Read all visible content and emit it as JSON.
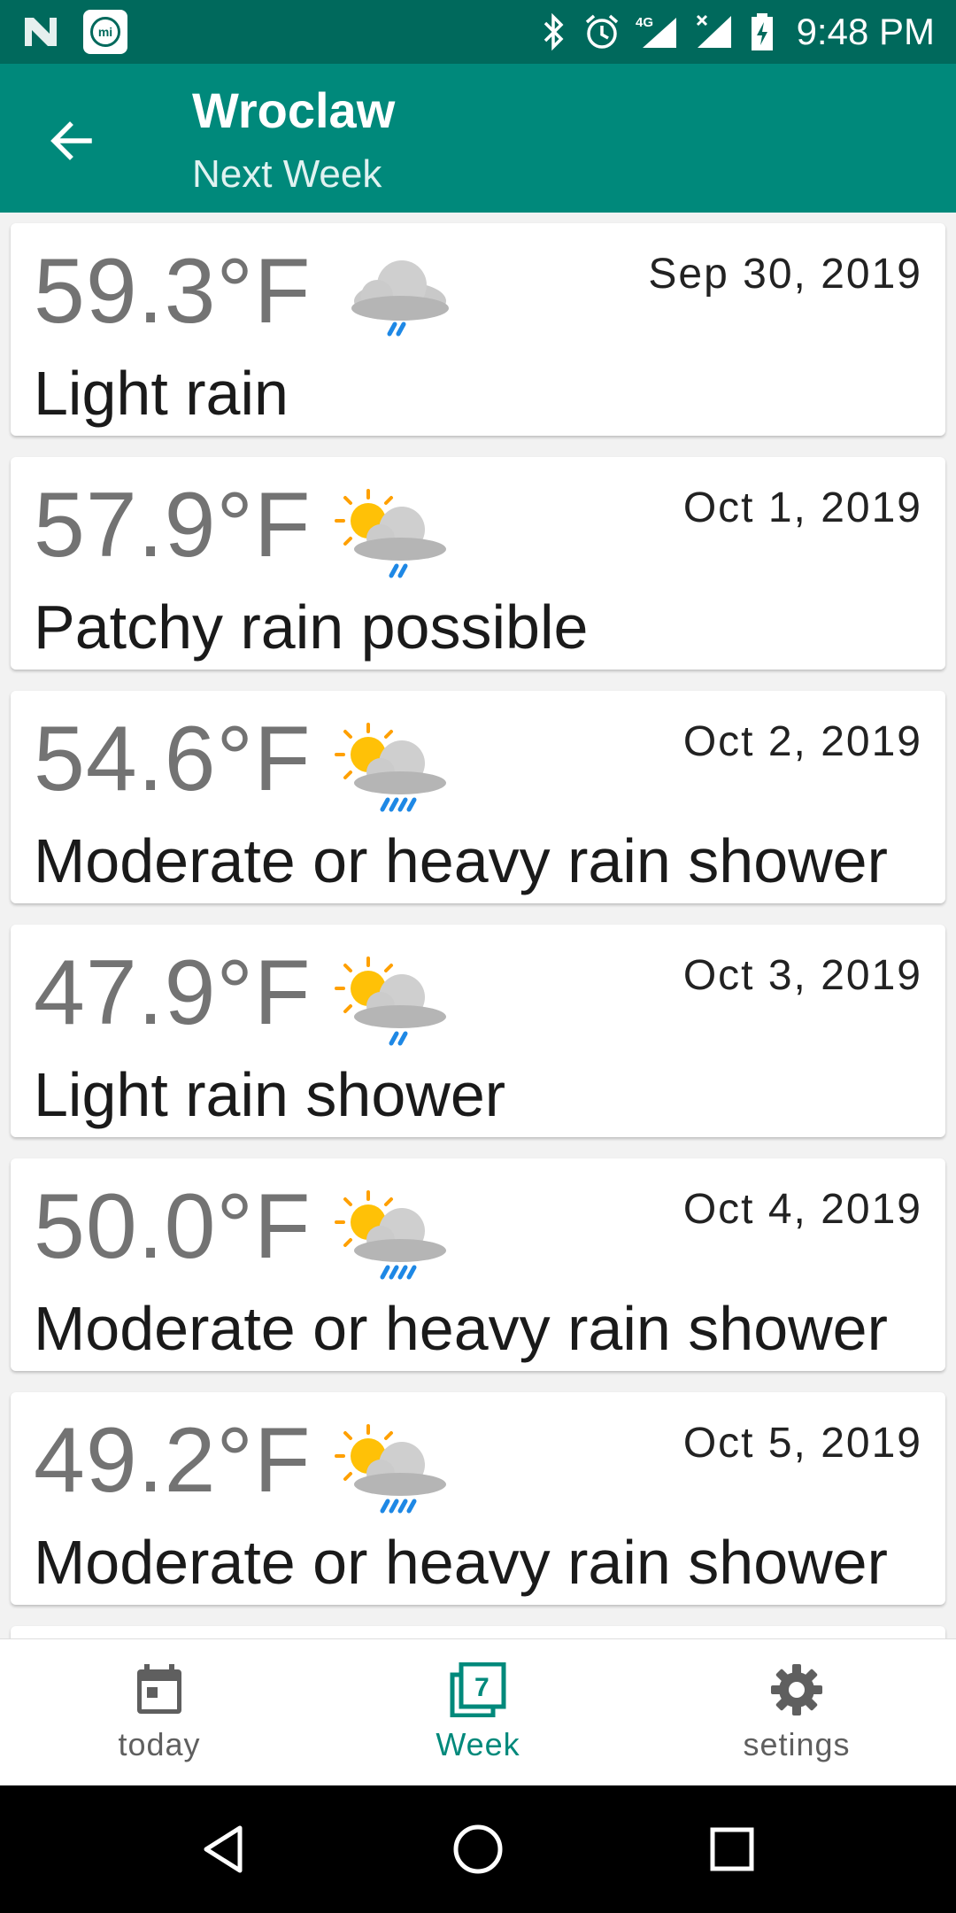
{
  "status_bar": {
    "time": "9:48 PM",
    "network": "4G",
    "icons": [
      "n-logo-icon",
      "mi-app-icon",
      "bluetooth-icon",
      "alarm-icon",
      "signal-4g-icon",
      "signal-x-icon",
      "battery-charging-icon"
    ]
  },
  "app_bar": {
    "title": "Wroclaw",
    "subtitle": "Next Week",
    "back_icon": "arrow-back-icon"
  },
  "forecast": [
    {
      "temp": "59.3°F",
      "date": "Sep 30, 2019",
      "desc": "Light rain",
      "icon": "cloud-light-rain-icon"
    },
    {
      "temp": "57.9°F",
      "date": "Oct 1, 2019",
      "desc": "Patchy rain possible",
      "icon": "sun-cloud-light-rain-icon"
    },
    {
      "temp": "54.6°F",
      "date": "Oct 2, 2019",
      "desc": "Moderate or heavy rain shower",
      "icon": "sun-cloud-heavy-rain-icon"
    },
    {
      "temp": "47.9°F",
      "date": "Oct 3, 2019",
      "desc": "Light rain shower",
      "icon": "sun-cloud-light-rain-icon"
    },
    {
      "temp": "50.0°F",
      "date": "Oct 4, 2019",
      "desc": "Moderate or heavy rain shower",
      "icon": "sun-cloud-heavy-rain-icon"
    },
    {
      "temp": "49.2°F",
      "date": "Oct 5, 2019",
      "desc": "Moderate or heavy rain shower",
      "icon": "sun-cloud-heavy-rain-icon"
    }
  ],
  "bottom_nav": [
    {
      "label": "today",
      "icon": "calendar-icon",
      "active": false
    },
    {
      "label": "Week",
      "icon": "week-calendar-icon",
      "active": true,
      "badge": "7"
    },
    {
      "label": "setings",
      "icon": "gear-icon",
      "active": false
    }
  ],
  "colors": {
    "status_bar": "#00695c",
    "app_bar": "#00897b",
    "active_nav": "#00897b",
    "inactive_nav": "#5f5f5f",
    "temp_text": "#737373"
  }
}
